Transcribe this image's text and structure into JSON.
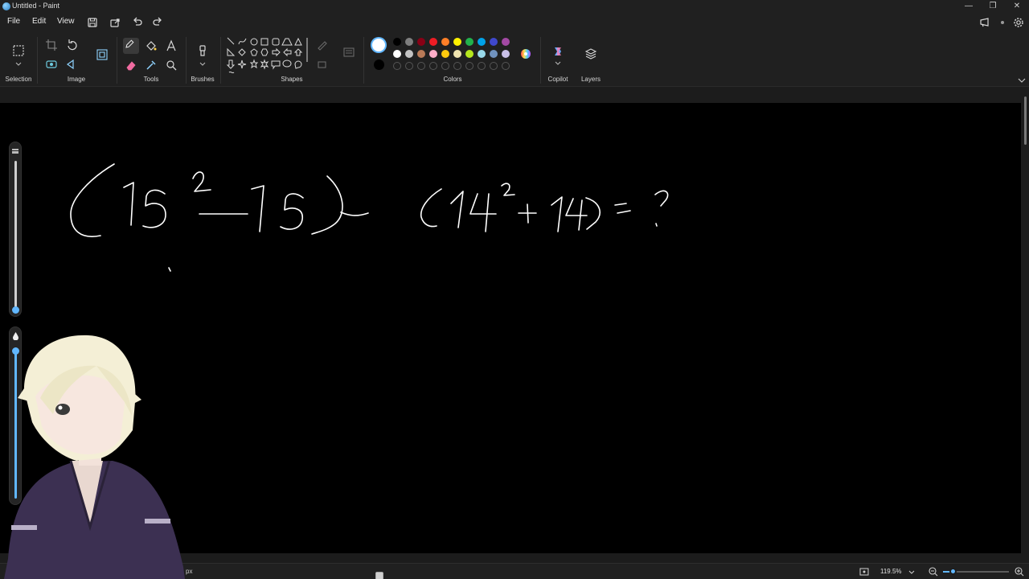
{
  "window": {
    "title": "Untitled - Paint",
    "controls": {
      "minimize": "—",
      "maximize": "❐",
      "close": "✕"
    }
  },
  "menu": {
    "file": "File",
    "edit": "Edit",
    "view": "View"
  },
  "ribbon": {
    "groups": {
      "selection": "Selection",
      "image": "Image",
      "tools": "Tools",
      "brushes": "Brushes",
      "shapes": "Shapes",
      "colors": "Colors",
      "copilot": "Copilot",
      "layers": "Layers"
    },
    "palette": {
      "row1": [
        "#000000",
        "#7f7f7f",
        "#880015",
        "#ed1c24",
        "#ff7f27",
        "#fff200",
        "#22b14c",
        "#00a2e8",
        "#3f48cc",
        "#a349a4"
      ],
      "row2": [
        "#ffffff",
        "#c3c3c3",
        "#b97a57",
        "#ffaec9",
        "#ffc90e",
        "#efe4b0",
        "#b5e61d",
        "#99d9ea",
        "#7092be",
        "#c8bfe7"
      ],
      "primary": "#ffffff",
      "secondary": "#000000",
      "custom_slots": 10
    }
  },
  "status": {
    "size_unit": "px",
    "zoom": "119.5%",
    "zoom_fraction": 0.15
  },
  "colors": {
    "accent": "#61b7ff",
    "chrome": "#202020",
    "canvas": "#000000",
    "ink": "#ffffff"
  }
}
